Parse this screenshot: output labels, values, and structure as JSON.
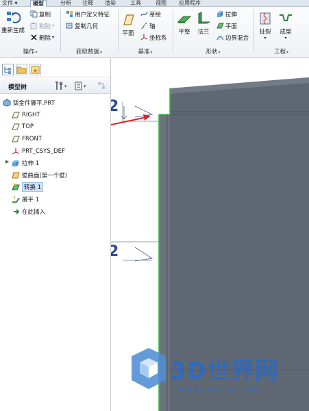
{
  "menu": {
    "tabs": [
      {
        "label": "文件 ▾",
        "active": false
      },
      {
        "label": "模型",
        "active": true
      },
      {
        "label": "分析",
        "active": false
      },
      {
        "label": "注释",
        "active": false
      },
      {
        "label": "渲染",
        "active": false
      },
      {
        "label": "工具",
        "active": false
      },
      {
        "label": "视图",
        "active": false
      },
      {
        "label": "应用程序",
        "active": false
      }
    ]
  },
  "ribbon": {
    "groups": {
      "operations": "操作",
      "get_data": "获取数据",
      "datum": "基准",
      "shapes": "形状",
      "engineering": "工程"
    },
    "buttons": {
      "regenerate": "重新生成",
      "copy": "复制",
      "paste": "粘贴",
      "delete": "删除",
      "user_defined_feature": "用户定义特征",
      "copy_geometry": "复制几何",
      "plane": "平面",
      "sketch": "草绘",
      "axis": "轴",
      "csys": "坐标系",
      "flat": "平整",
      "flange": "法兰",
      "extrude": "拉伸",
      "planar": "平面",
      "boundary_blend": "边界混合",
      "rip": "扯裂",
      "form": "成型"
    }
  },
  "panel": {
    "tree_title": "模型树",
    "items": [
      {
        "label": "钣金件展平.PRT",
        "icon": "part-icon"
      },
      {
        "label": "RIGHT",
        "icon": "datum-plane-icon"
      },
      {
        "label": "TOP",
        "icon": "datum-plane-icon"
      },
      {
        "label": "FRONT",
        "icon": "datum-plane-icon"
      },
      {
        "label": "PRT_CSYS_DEF",
        "icon": "csys-icon"
      },
      {
        "label": "拉伸 1",
        "icon": "extrude-icon"
      },
      {
        "label": "壁曲面(第一个壁)",
        "icon": "wall-icon"
      },
      {
        "label": "转换 1",
        "icon": "convert-icon"
      },
      {
        "label": "展平 1",
        "icon": "unbend-icon"
      },
      {
        "label": "在此插入",
        "icon": "insert-here-icon"
      }
    ]
  },
  "viewport": {
    "ghost_label_1": "2",
    "ghost_label_2": "2"
  },
  "watermark": {
    "text": "3D世界网",
    "url": "WWW.3DSJW.COM"
  },
  "colors": {
    "accent_green": "#3fb84a",
    "annotation_arrow": "#d8232a",
    "model_fill": "#5d6670",
    "selection": "#cfe3f7"
  }
}
